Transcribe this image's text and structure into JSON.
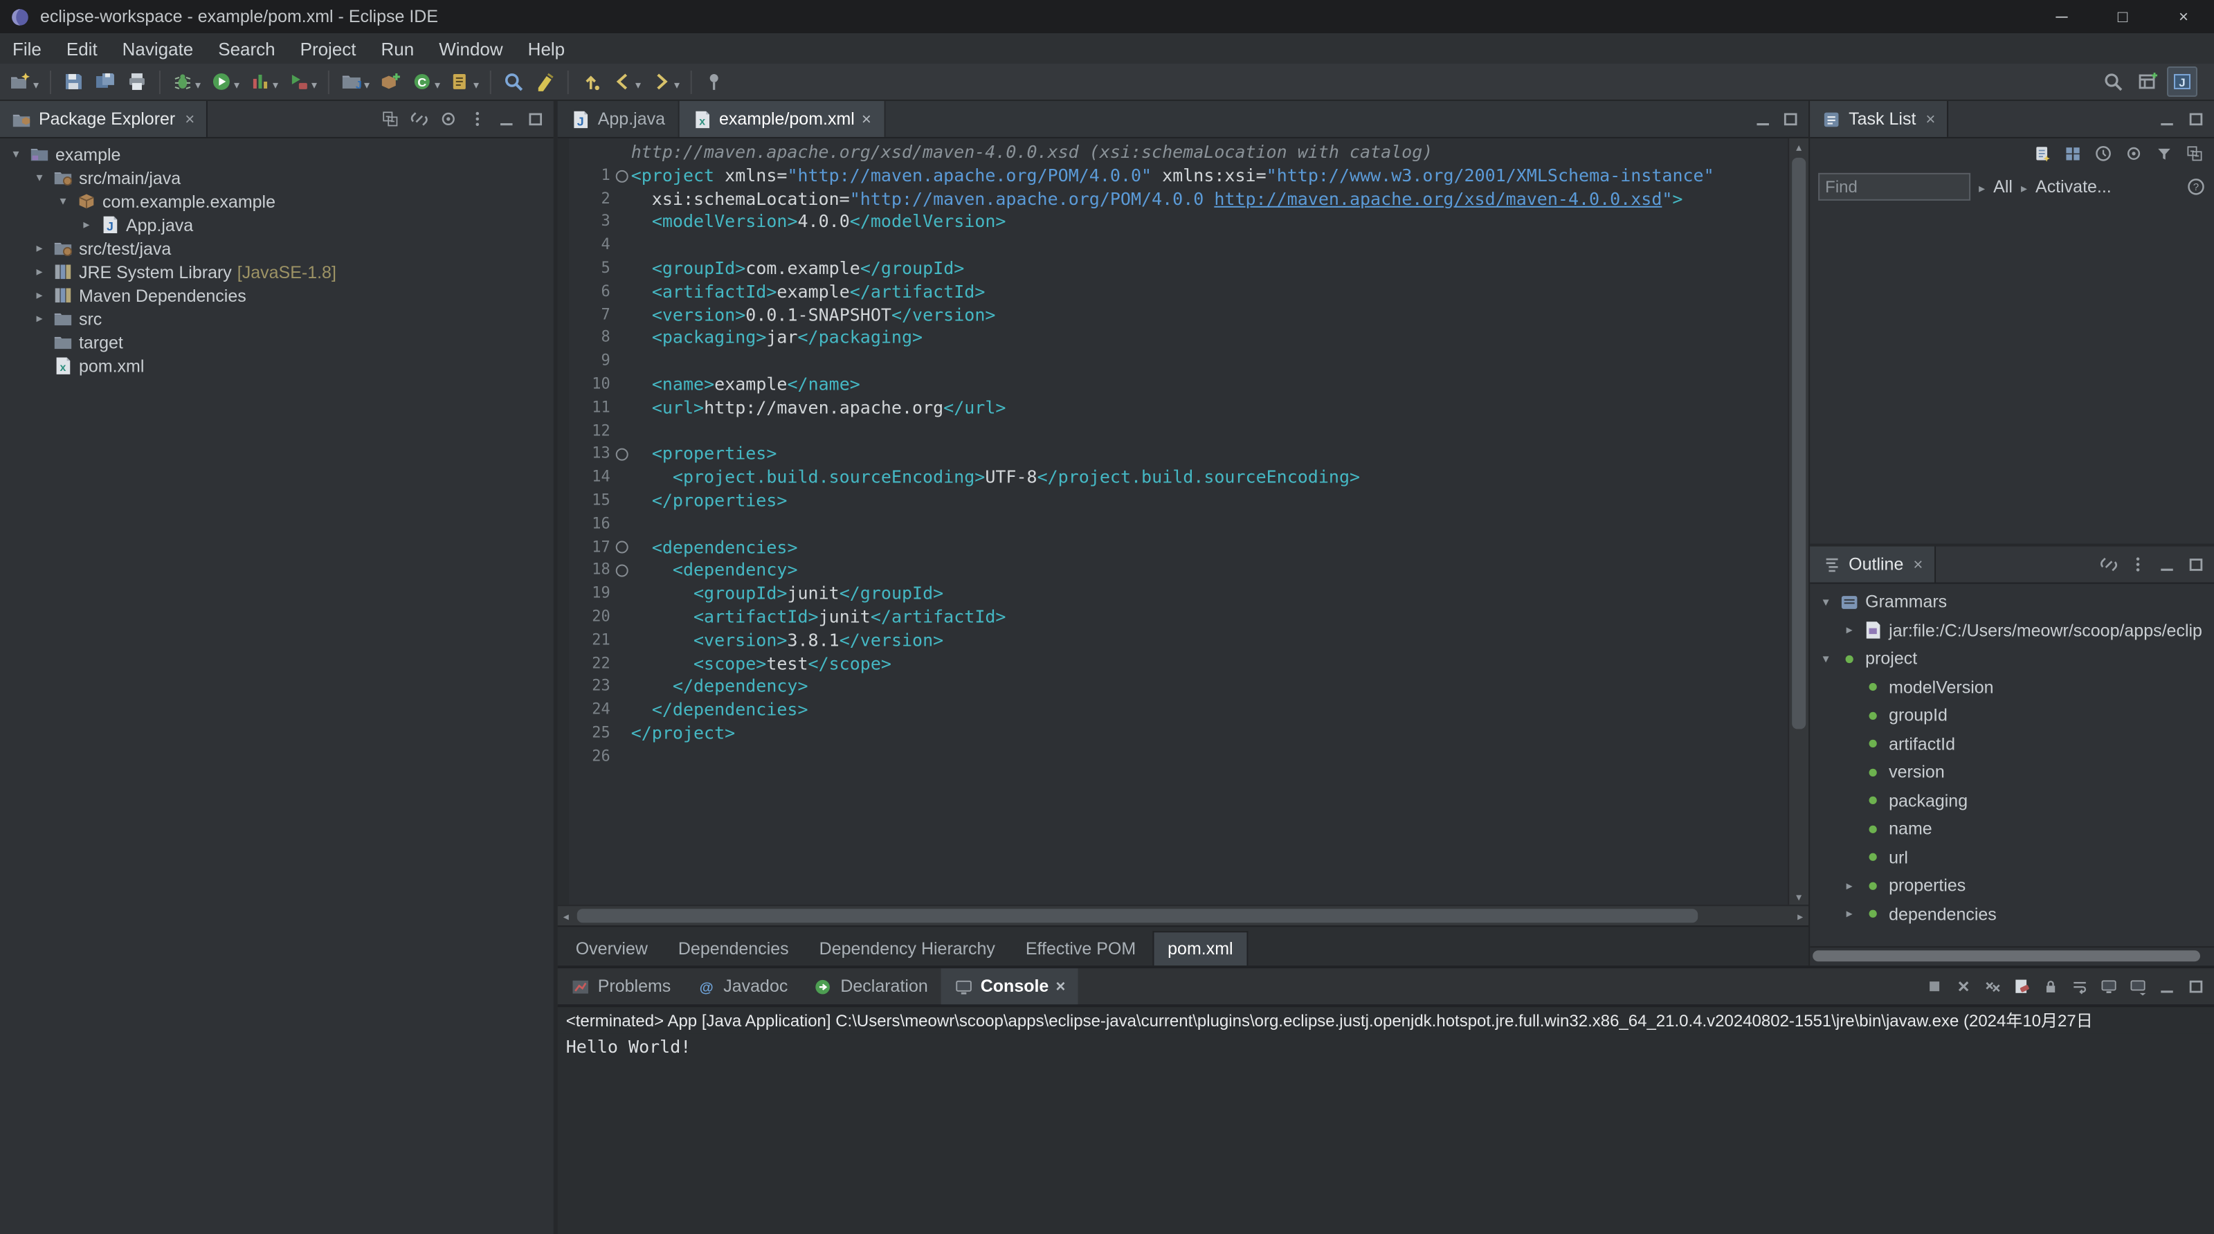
{
  "window": {
    "title": "eclipse-workspace - example/pom.xml - Eclipse IDE",
    "minimize_glyph": "─",
    "maximize_glyph": "□",
    "close_glyph": "×"
  },
  "menubar": {
    "items": [
      "File",
      "Edit",
      "Navigate",
      "Search",
      "Project",
      "Run",
      "Window",
      "Help"
    ]
  },
  "toolbar": {
    "buttons": [
      {
        "name": "new-wizard",
        "dropdown": true
      },
      {
        "sep": true
      },
      {
        "name": "save",
        "dropdown": false
      },
      {
        "name": "save-all",
        "dropdown": false
      },
      {
        "name": "print",
        "dropdown": false
      },
      {
        "sep": true
      },
      {
        "name": "debug",
        "dropdown": true
      },
      {
        "name": "run",
        "dropdown": true
      },
      {
        "name": "coverage",
        "dropdown": true
      },
      {
        "name": "external-tools",
        "dropdown": true
      },
      {
        "sep": true
      },
      {
        "name": "new-java-project",
        "dropdown": true
      },
      {
        "name": "new-package",
        "dropdown": false
      },
      {
        "name": "new-class",
        "dropdown": true
      },
      {
        "name": "open-task",
        "dropdown": true
      },
      {
        "sep": true
      },
      {
        "name": "search",
        "dropdown": false
      },
      {
        "name": "mark-occurrences",
        "dropdown": false
      },
      {
        "sep": true
      },
      {
        "name": "last-edit-location",
        "dropdown": false
      },
      {
        "name": "back",
        "dropdown": true
      },
      {
        "name": "forward",
        "dropdown": true
      },
      {
        "sep": true
      },
      {
        "name": "pin-editor",
        "dropdown": false
      }
    ],
    "right_buttons": [
      {
        "name": "search-magnifier"
      },
      {
        "name": "open-perspective"
      },
      {
        "name": "java-perspective",
        "active": true
      }
    ]
  },
  "package_explorer": {
    "title": "Package Explorer",
    "header_icons": [
      "collapse-all",
      "link-with-editor",
      "focus",
      "view-menu",
      "minimize",
      "maximize"
    ],
    "items": [
      {
        "label": "example",
        "icon": "project",
        "depth": 0,
        "arrow": "expanded"
      },
      {
        "label": "src/main/java",
        "icon": "source-folder",
        "depth": 1,
        "arrow": "expanded"
      },
      {
        "label": "com.example.example",
        "icon": "package",
        "depth": 2,
        "arrow": "expanded"
      },
      {
        "label": "App.java",
        "icon": "java-file",
        "depth": 3,
        "arrow": "collapsed"
      },
      {
        "label": "src/test/java",
        "icon": "source-folder",
        "depth": 1,
        "arrow": "collapsed"
      },
      {
        "label": "JRE System Library",
        "suffix": " [JavaSE-1.8]",
        "icon": "library",
        "depth": 1,
        "arrow": "collapsed"
      },
      {
        "label": "Maven Dependencies",
        "icon": "library",
        "depth": 1,
        "arrow": "collapsed"
      },
      {
        "label": "src",
        "icon": "folder",
        "depth": 1,
        "arrow": "collapsed"
      },
      {
        "label": "target",
        "icon": "folder",
        "depth": 1,
        "arrow": "none"
      },
      {
        "label": "pom.xml",
        "icon": "xml-file",
        "depth": 1,
        "arrow": "none"
      }
    ]
  },
  "editor": {
    "tabs": [
      {
        "label": "App.java",
        "icon": "java-file"
      },
      {
        "label": "example/pom.xml",
        "icon": "xml-file",
        "active": true,
        "close": true
      }
    ],
    "mining_annotation": "http://maven.apache.org/xsd/maven-4.0.0.xsd (xsi:schemaLocation with catalog)",
    "link_text": "http://maven.apache.org/xsd/maven-4.0.0.xsd",
    "folded_lines": [
      1,
      13,
      17,
      18
    ],
    "lines": [
      "<project xmlns=\"http://maven.apache.org/POM/4.0.0\" xmlns:xsi=\"http://www.w3.org/2001/XMLSchema-instance\"",
      "  xsi:schemaLocation=\"http://maven.apache.org/POM/4.0.0 http://maven.apache.org/xsd/maven-4.0.0.xsd\">",
      "  <modelVersion>4.0.0</modelVersion>",
      "",
      "  <groupId>com.example</groupId>",
      "  <artifactId>example</artifactId>",
      "  <version>0.0.1-SNAPSHOT</version>",
      "  <packaging>jar</packaging>",
      "",
      "  <name>example</name>",
      "  <url>http://maven.apache.org</url>",
      "",
      "  <properties>",
      "    <project.build.sourceEncoding>UTF-8</project.build.sourceEncoding>",
      "  </properties>",
      "",
      "  <dependencies>",
      "    <dependency>",
      "      <groupId>junit</groupId>",
      "      <artifactId>junit</artifactId>",
      "      <version>3.8.1</version>",
      "      <scope>test</scope>",
      "    </dependency>",
      "  </dependencies>",
      "</project>",
      ""
    ],
    "page_tabs": [
      {
        "label": "Overview"
      },
      {
        "label": "Dependencies"
      },
      {
        "label": "Dependency Hierarchy"
      },
      {
        "label": "Effective POM"
      },
      {
        "label": "pom.xml",
        "active": true
      }
    ]
  },
  "task_list": {
    "title": "Task List",
    "header_icons": [
      "minimize",
      "maximize"
    ],
    "toolbar_icons": [
      "new-task",
      "categorized",
      "scheduled",
      "focus",
      "filter",
      "collapse-all"
    ],
    "find_placeholder": "Find",
    "scope_label": "All",
    "activate_label": "Activate...",
    "help_icon": "help"
  },
  "outline": {
    "title": "Outline",
    "header_icons": [
      "link-with-editor",
      "view-menu",
      "minimize",
      "maximize"
    ],
    "items": [
      {
        "label": "Grammars",
        "icon": "grammars",
        "depth": 0,
        "arrow": "expanded"
      },
      {
        "label": "jar:file:/C:/Users/meowr/scoop/apps/eclip",
        "icon": "grammar-file",
        "depth": 1,
        "arrow": "collapsed"
      },
      {
        "label": "project",
        "icon": "xml-element",
        "depth": 0,
        "arrow": "expanded"
      },
      {
        "label": "modelVersion",
        "icon": "xml-element",
        "depth": 1,
        "arrow": "none"
      },
      {
        "label": "groupId",
        "icon": "xml-element",
        "depth": 1,
        "arrow": "none"
      },
      {
        "label": "artifactId",
        "icon": "xml-element",
        "depth": 1,
        "arrow": "none"
      },
      {
        "label": "version",
        "icon": "xml-element",
        "depth": 1,
        "arrow": "none"
      },
      {
        "label": "packaging",
        "icon": "xml-element",
        "depth": 1,
        "arrow": "none"
      },
      {
        "label": "name",
        "icon": "xml-element",
        "depth": 1,
        "arrow": "none"
      },
      {
        "label": "url",
        "icon": "xml-element",
        "depth": 1,
        "arrow": "none"
      },
      {
        "label": "properties",
        "icon": "xml-element",
        "depth": 1,
        "arrow": "collapsed"
      },
      {
        "label": "dependencies",
        "icon": "xml-element",
        "depth": 1,
        "arrow": "collapsed"
      }
    ]
  },
  "console": {
    "tabs": [
      {
        "label": "Problems",
        "icon": "problems-view"
      },
      {
        "label": "Javadoc",
        "icon": "javadoc-view"
      },
      {
        "label": "Declaration",
        "icon": "declaration-view"
      },
      {
        "label": "Console",
        "icon": "console-view",
        "active": true,
        "close": true
      }
    ],
    "toolbar_icons": [
      "terminate",
      "remove-launch",
      "remove-all-terminated",
      "clear-console",
      "scroll-lock",
      "word-wrap",
      "display-selected-console",
      "open-console",
      "minimize",
      "maximize"
    ],
    "header_line": "<terminated> App [Java Application] C:\\Users\\meowr\\scoop\\apps\\eclipse-java\\current\\plugins\\org.eclipse.justj.openjdk.hotspot.jre.full.win32.x86_64_21.0.4.v20240802-1551\\jre\\bin\\javaw.exe (2024年10月27日",
    "output": "Hello World!"
  },
  "colors": {
    "xml_tag": "#45b8c4",
    "xml_string": "#5b9bd8",
    "xml_text": "#d2d6d9",
    "mining": "#8a9298",
    "line_number": "#7b8288",
    "editor_bg": "#2d3034",
    "panel_bg": "#2f3236",
    "header_bg": "#33363a",
    "active_tab_bg": "#40464c",
    "console_text": "#dcdfe2",
    "suffix": "#9d9365"
  }
}
